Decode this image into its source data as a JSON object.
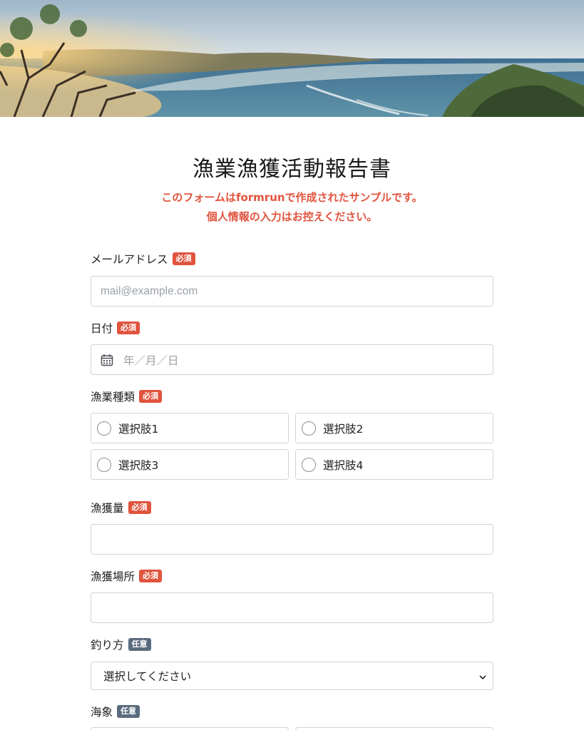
{
  "form": {
    "title": "漁業漁獲活動報告書",
    "notice_line1": "このフォームはformrunで作成されたサンプルです。",
    "notice_line2": "個人情報の入力はお控えください。"
  },
  "badges": {
    "required": "必須",
    "optional": "任意"
  },
  "fields": {
    "email": {
      "label": "メールアドレス",
      "placeholder": "mail@example.com"
    },
    "date": {
      "label": "日付",
      "placeholder": "年／月／日"
    },
    "fishing_type": {
      "label": "漁業種類",
      "options": [
        "選択肢1",
        "選択肢2",
        "選択肢3",
        "選択肢4"
      ]
    },
    "catch_amount": {
      "label": "漁獲量"
    },
    "catch_location": {
      "label": "漁獲場所"
    },
    "method": {
      "label": "釣り方",
      "selected": "選択してください"
    },
    "sea_conditions": {
      "label": "海象"
    }
  },
  "colors": {
    "required_badge": "#e0533d",
    "optional_badge": "#5b6b7e",
    "notice_text": "#e0533d"
  },
  "icons": {
    "date": "calendar-icon",
    "select": "chevron-down-icon"
  }
}
